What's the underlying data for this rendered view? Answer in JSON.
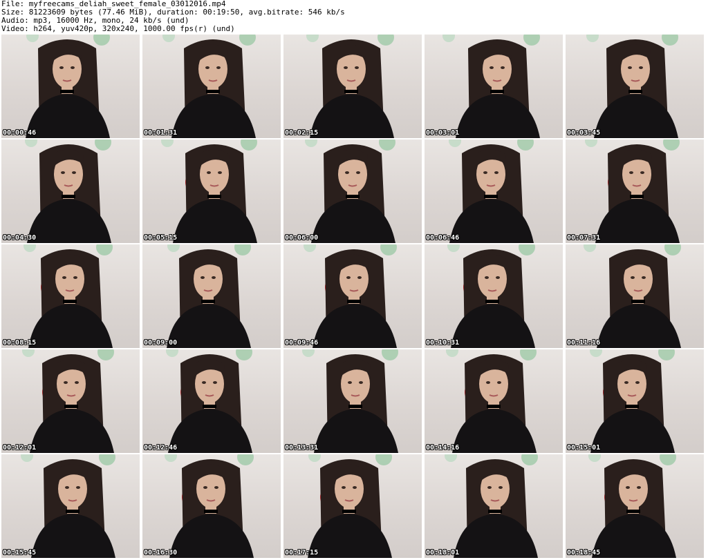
{
  "header": {
    "file_line": "File: myfreecams_deliah_sweet_female_03012016.mp4",
    "size_line": "Size: 81223609 bytes (77.46 MiB), duration: 00:19:50, avg.bitrate: 546 kb/s",
    "audio_line": "Audio: mp3, 16000 Hz, mono, 24 kb/s (und)",
    "video_line": "Video: h264, yuv420p, 320x240, 1000.00 fps(r) (und)"
  },
  "thumbnails": [
    {
      "time": "00:00:46"
    },
    {
      "time": "00:01:31"
    },
    {
      "time": "00:02:15"
    },
    {
      "time": "00:03:01"
    },
    {
      "time": "00:03:45"
    },
    {
      "time": "00:04:30"
    },
    {
      "time": "00:05:15"
    },
    {
      "time": "00:06:00"
    },
    {
      "time": "00:06:46"
    },
    {
      "time": "00:07:31"
    },
    {
      "time": "00:08:15"
    },
    {
      "time": "00:09:00"
    },
    {
      "time": "00:09:46"
    },
    {
      "time": "00:10:31"
    },
    {
      "time": "00:11:16"
    },
    {
      "time": "00:12:01"
    },
    {
      "time": "00:12:46"
    },
    {
      "time": "00:13:31"
    },
    {
      "time": "00:14:16"
    },
    {
      "time": "00:15:01"
    },
    {
      "time": "00:15:45"
    },
    {
      "time": "00:16:30"
    },
    {
      "time": "00:17:15"
    },
    {
      "time": "00:18:01"
    },
    {
      "time": "00:18:45"
    }
  ],
  "colors": {
    "hair": "#2a1f1c",
    "skin": "#d9b49c",
    "dress": "#141214",
    "balloon": "#d8232a"
  }
}
